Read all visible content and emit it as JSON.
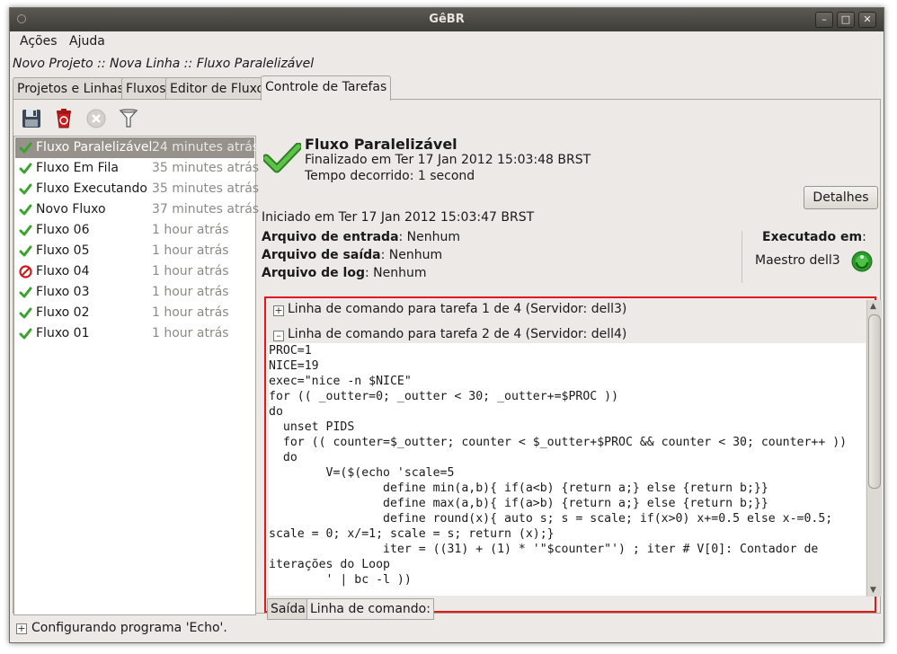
{
  "window": {
    "title": "GêBR"
  },
  "menu": [
    {
      "label": "Ações"
    },
    {
      "label": "Ajuda"
    }
  ],
  "breadcrumb": "Novo Projeto :: Nova Linha :: Fluxo Paralelizável",
  "tabs": [
    {
      "label": "Projetos e Linhas"
    },
    {
      "label": "Fluxos"
    },
    {
      "label": "Editor de Fluxo"
    },
    {
      "label": "Controle de Tarefas",
      "active": true
    }
  ],
  "toolbar": [
    {
      "icon": "save-icon"
    },
    {
      "icon": "delete-icon"
    },
    {
      "icon": "cancel-icon"
    },
    {
      "icon": "filter-icon"
    }
  ],
  "jobs": [
    {
      "name": "Fluxo Paralelizável",
      "time": "24 minutes atrás",
      "status": "done",
      "selected": true
    },
    {
      "name": "Fluxo Em Fila",
      "time": "35 minutes atrás",
      "status": "done"
    },
    {
      "name": "Fluxo Executando",
      "time": "35 minutes atrás",
      "status": "done"
    },
    {
      "name": "Novo Fluxo",
      "time": "37 minutes atrás",
      "status": "done"
    },
    {
      "name": "Fluxo 06",
      "time": "1 hour atrás",
      "status": "done"
    },
    {
      "name": "Fluxo 05",
      "time": "1 hour atrás",
      "status": "done"
    },
    {
      "name": "Fluxo 04",
      "time": "1 hour atrás",
      "status": "failed"
    },
    {
      "name": "Fluxo 03",
      "time": "1 hour atrás",
      "status": "done"
    },
    {
      "name": "Fluxo 02",
      "time": "1 hour atrás",
      "status": "done"
    },
    {
      "name": "Fluxo 01",
      "time": "1 hour atrás",
      "status": "done"
    }
  ],
  "detail": {
    "title": "Fluxo Paralelizável",
    "finished": "Finalizado em Ter 17 Jan 2012 15:03:48 BRST",
    "elapsed": "Tempo decorrido: 1 second",
    "details_button": "Detalhes",
    "started": "Iniciado em Ter 17 Jan 2012 15:03:47 BRST",
    "input_label": "Arquivo de entrada",
    "input_value": ": Nenhum",
    "output_label": "Arquivo de saída",
    "output_value": ": Nenhum",
    "log_label": "Arquivo de log",
    "log_value": ": Nenhum",
    "executed_label": "Executado em",
    "executed_colon": ":",
    "server": "Maestro dell3"
  },
  "commands": {
    "task1": "Linha de comando para tarefa 1 de 4 (Servidor: dell3)",
    "task2": "Linha de comando para tarefa 2 de 4 (Servidor: dell4)",
    "code": "PROC=1\nNICE=19\nexec=\"nice -n $NICE\"\nfor (( _outter=0; _outter < 30; _outter+=$PROC ))\ndo\n  unset PIDS\n  for (( counter=$_outter; counter < $_outter+$PROC && counter < 30; counter++ ))\n  do\n        V=($(echo 'scale=5\n                define min(a,b){ if(a<b) {return a;} else {return b;}}\n                define max(a,b){ if(a>b) {return a;} else {return b;}}\n                define round(x){ auto s; s = scale; if(x>0) x+=0.5 else x-=0.5;\nscale = 0; x/=1; scale = s; return (x);}\n                iter = ((31) + (1) * '\"$counter\"') ; iter # V[0]: Contador de\niterações do Loop\n        ' | bc -l ))",
    "tabs": [
      {
        "label": "Saída"
      },
      {
        "label": "Linha de comando:",
        "active": true
      }
    ]
  },
  "status": {
    "text": "Configurando programa 'Echo'."
  },
  "colors": {
    "accent_red": "#e0191e",
    "check_green": "#3aa32c",
    "selected_row": "#96918a"
  }
}
